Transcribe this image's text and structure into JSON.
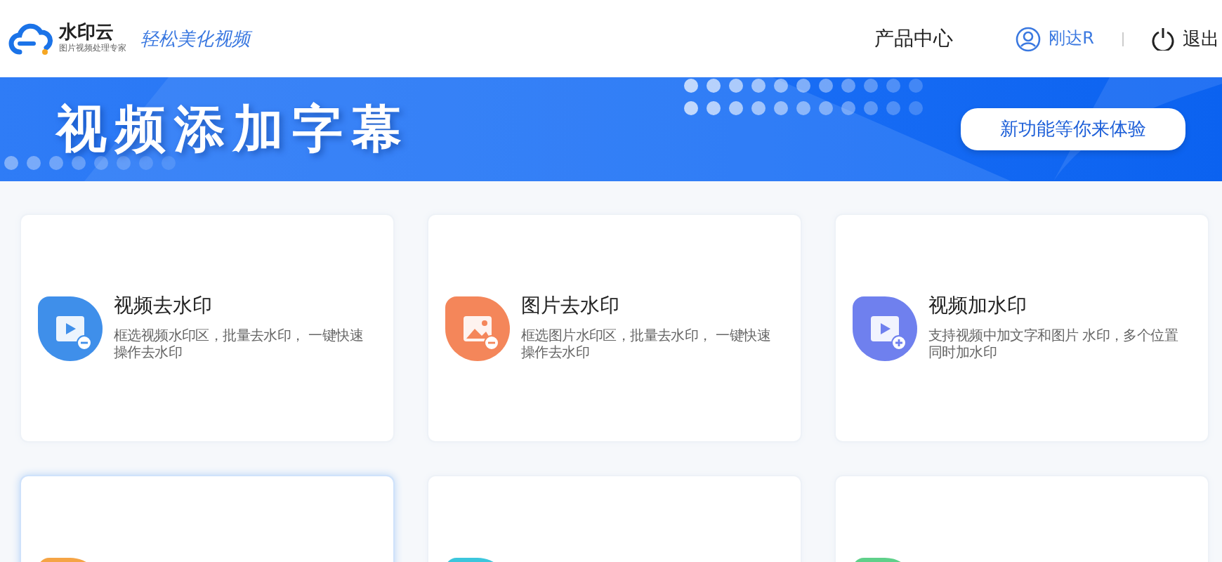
{
  "header": {
    "logo_name": "水印云",
    "logo_tagline": "图片视频处理专家",
    "slogan": "轻松美化视频",
    "nav": [
      {
        "label": "产品中心"
      }
    ],
    "user": {
      "name": "刚达R"
    },
    "logout": "退出"
  },
  "banner": {
    "title": "视频添加字幕",
    "button": "新功能等你来体验"
  },
  "cards": [
    {
      "title": "视频去水印",
      "description": "框选视频水印区，批量去水印， 一键快速操作去水印",
      "kind": "video-remove",
      "color": "#3f8fea",
      "selected": false
    },
    {
      "title": "图片去水印",
      "description": "框选图片水印区，批量去水印， 一键快速操作去水印",
      "kind": "image-remove",
      "color": "#f4865a",
      "selected": false
    },
    {
      "title": "视频加水印",
      "description": "支持视频中加文字和图片 水印，多个位置同时加水印",
      "kind": "video-add",
      "color": "#6f80ee",
      "selected": false
    },
    {
      "kind": "blank",
      "color": "#f5a445",
      "selected": true
    },
    {
      "kind": "blank",
      "color": "#3cc6dc",
      "selected": false
    },
    {
      "kind": "blank",
      "color": "#5fd08a",
      "selected": false
    }
  ]
}
